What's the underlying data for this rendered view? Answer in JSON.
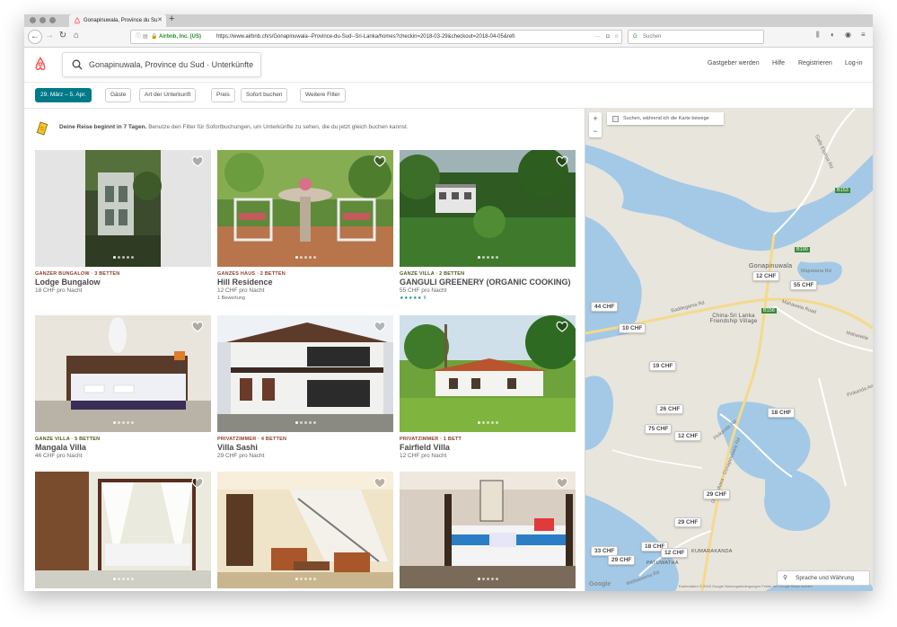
{
  "browser": {
    "tab_title": "Gonapinuwala, Province du Sud",
    "tab_close": "✕",
    "new_tab": "+",
    "org_name": "Airbnb, Inc. (US)",
    "url": "https://www.airbnb.ch/s/Gonapinuwala--Province-du-Sud--Sri-Lanka/homes?checkin=2018-03-29&checkout=2018-04-05&refi",
    "search_placeholder": "Suchen"
  },
  "header": {
    "search_text": "Gonapinuwala, Province du Sud · Unterkünfte",
    "links": [
      "Gastgeber werden",
      "Hilfe",
      "Registrieren",
      "Log-in"
    ]
  },
  "filters": [
    "29. März – 5. Apr.",
    "Gäste",
    "Art der Unterkunft",
    "Preis",
    "Sofort buchen",
    "Weitere Filter"
  ],
  "notice": {
    "bold": "Deine Reise beginnt in 7 Tagen.",
    "text": " Benutze den Filter für Sofortbuchungen, um Unterkünfte zu sehen, die du jetzt gleich buchen kannst."
  },
  "listings": [
    {
      "type": "GANZER BUNGALOW · 3 BETTEN",
      "name": "Lodge Bungalow",
      "price": "18 CHF pro Nacht",
      "extra": ""
    },
    {
      "type": "GANZES HAUS · 2 BETTEN",
      "name": "Hill Residence",
      "price": "12 CHF pro Nacht",
      "extra": "1 Bewertung"
    },
    {
      "type": "GANZE VILLA · 2 BETTEN",
      "name": "GANGULI GREENERY (ORGANIC COOKING)",
      "price": "55 CHF pro Nacht",
      "extra": "6"
    },
    {
      "type": "GANZE VILLA · 5 BETTEN",
      "name": "Mangala Villa",
      "price": "46 CHF pro Nacht",
      "extra": ""
    },
    {
      "type": "PRIVATZIMMER · 4 BETTEN",
      "name": "Villa Sashi",
      "price": "29 CHF pro Nacht",
      "extra": ""
    },
    {
      "type": "PRIVATZIMMER · 1 BETT",
      "name": "Fairfield Villa",
      "price": "12 CHF pro Nacht",
      "extra": ""
    }
  ],
  "map": {
    "checkbox_label": "Suchen, während ich die Karte bewege",
    "zoom_in": "+",
    "zoom_out": "−",
    "pins": [
      "12 CHF",
      "55 CHF",
      "44 CHF",
      "10 CHF",
      "19 CHF",
      "26 CHF",
      "18 CHF",
      "75 CHF",
      "12 CHF",
      "29 CHF",
      "29 CHF",
      "33 CHF",
      "29 CHF",
      "18 CHF",
      "12 CHF"
    ],
    "places": [
      "Gonapinuwala",
      "China-Sri Lanka Friendship Village",
      "PATUWATHA",
      "KUMARAKANDA"
    ],
    "roads": [
      "Baddegama Rd",
      "Mahawela Road",
      "Dodanduwa - Gonapinuwala Rd",
      "Pinkanda Rd",
      "Galle Elpitiya Rd",
      "Majuwana Rd",
      "Wellaweena Rd",
      "Mahawela",
      "Pinkanda Ambalama",
      "B153",
      "B156",
      "B190"
    ],
    "lang_button": "Sprache und Währung",
    "google": "Google",
    "attribution": "Kartendaten © 2018 Google    Nutzungsbedingungen    Fehler bei Google Maps melden"
  }
}
